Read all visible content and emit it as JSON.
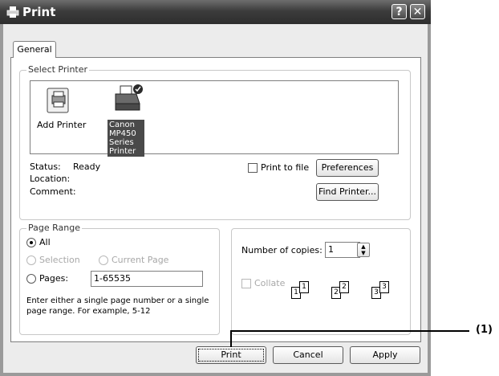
{
  "window": {
    "title": "Print",
    "help_button": "?",
    "close_button": "✕"
  },
  "tabs": [
    {
      "label": "General"
    }
  ],
  "select_printer": {
    "legend": "Select Printer",
    "items": [
      {
        "label": "Add Printer",
        "icon": "add-printer-icon"
      },
      {
        "label_line1": "Canon MP450",
        "label_line2": "Series Printer",
        "icon": "printer-default-icon",
        "selected": true
      }
    ],
    "status_label": "Status:",
    "status_value": "Ready",
    "location_label": "Location:",
    "comment_label": "Comment:",
    "print_to_file_label": "Print to file",
    "preferences_button": "Preferences",
    "find_printer_button": "Find Printer..."
  },
  "page_range": {
    "legend": "Page Range",
    "options": [
      {
        "label": "All",
        "selected": true,
        "enabled": true
      },
      {
        "label": "Selection",
        "selected": false,
        "enabled": false
      },
      {
        "label": "Current Page",
        "selected": false,
        "enabled": false
      },
      {
        "label": "Pages:",
        "selected": false,
        "enabled": true
      }
    ],
    "pages_value": "1-65535",
    "help_line1": "Enter either a single page number or a single",
    "help_line2": "page range.  For example, 5-12"
  },
  "copies": {
    "label": "Number of copies:",
    "value": "1",
    "collate_label": "Collate",
    "page_numbers": [
      "1",
      "1",
      "2",
      "2",
      "3",
      "3"
    ]
  },
  "buttons": {
    "print": "Print",
    "cancel": "Cancel",
    "apply": "Apply"
  },
  "callout": {
    "label": "(1)"
  }
}
